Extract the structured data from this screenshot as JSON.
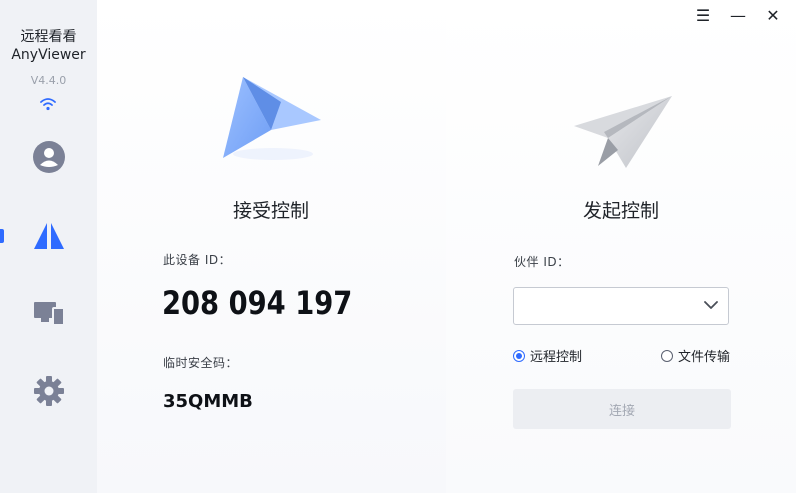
{
  "app": {
    "name_cn": "远程看看",
    "name_en": "AnyViewer",
    "version": "V4.4.0"
  },
  "sidebar": {
    "items": [
      {
        "name": "account",
        "icon": "user-icon"
      },
      {
        "name": "remote-control",
        "icon": "anyviewer-logo-icon",
        "active": true
      },
      {
        "name": "devices",
        "icon": "devices-icon"
      },
      {
        "name": "settings",
        "icon": "gear-icon"
      }
    ]
  },
  "window_controls": {
    "menu": "☰",
    "minimize": "—",
    "close": "✕"
  },
  "receive": {
    "title": "接受控制",
    "device_id_label": "此设备 ID：",
    "device_id": "208 094 197",
    "temp_code_label": "临时安全码：",
    "temp_code": "35QMMB"
  },
  "initiate": {
    "title": "发起控制",
    "partner_id_label": "伙伴 ID：",
    "partner_id_value": "",
    "options": [
      {
        "label": "远程控制",
        "checked": true
      },
      {
        "label": "文件传输",
        "checked": false
      }
    ],
    "connect_label": "连接"
  },
  "colors": {
    "accent": "#2f6bff",
    "sidebar_bg": "#f0f2f6",
    "icon_gray": "#7b8196"
  }
}
